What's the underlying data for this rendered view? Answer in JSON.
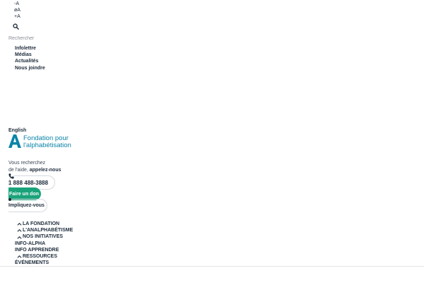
{
  "font_tools": {
    "decrease": "-A",
    "reset": "øA",
    "increase": "+A"
  },
  "search": {
    "placeholder": "Rechercher"
  },
  "utility_nav": {
    "items": [
      "Infolettre",
      "Médias",
      "Actualités",
      "Nous joindre"
    ]
  },
  "language_link": "English",
  "logo": {
    "line1": "Fondation pour",
    "line2": "l'alphabétisation"
  },
  "help": {
    "line1": "Vous recherchez",
    "line2_prefix": "de l'aide,",
    "line2_strong": "appelez-nous",
    "phone": "1 888 488-3888"
  },
  "cta": {
    "donate": "Faire un don",
    "involve": "Impliquez-vous"
  },
  "main_nav": {
    "items": [
      {
        "label": "LA FONDATION"
      },
      {
        "label": "L'ANALPHABÉTISME"
      },
      {
        "label": "NOS INITIATIVES"
      },
      {
        "label": "INFO-ALPHA"
      },
      {
        "label": "INFO APPRENDRE"
      },
      {
        "label": "RESSOURCES"
      },
      {
        "label": "ÉVÉNEMENTS"
      }
    ]
  },
  "colors": {
    "brand": "#0a84a8",
    "accent_green": "#1aa37a",
    "text": "#1d2b3a"
  }
}
